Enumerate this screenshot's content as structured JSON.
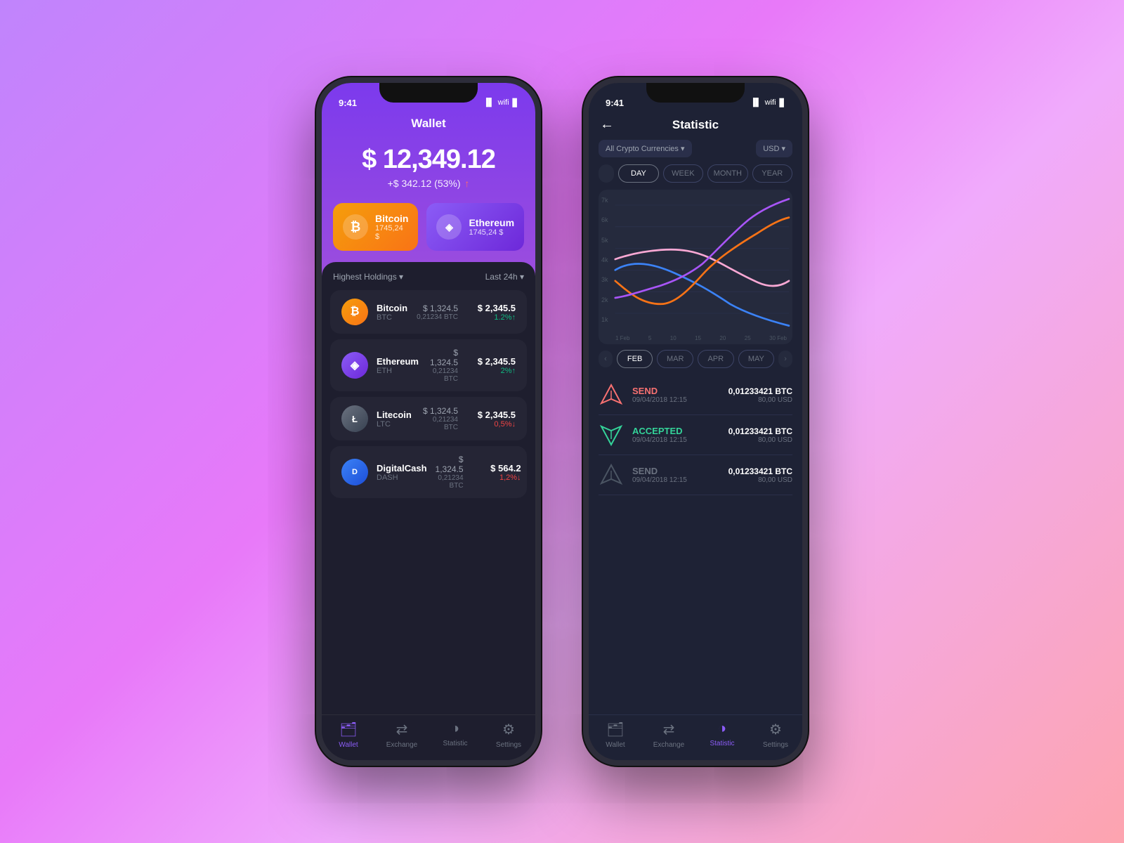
{
  "background": "#d946ef",
  "phone1": {
    "status_time": "9:41",
    "screen_title": "Wallet",
    "balance": "$ 12,349.12",
    "balance_change": "+$ 342.12 (53%)",
    "cards": [
      {
        "name": "Bitcoin",
        "amount": "1745,24 $",
        "type": "bitcoin"
      },
      {
        "name": "Ethereum",
        "amount": "1745,24 $",
        "type": "ethereum"
      }
    ],
    "list_header_left": "Highest Holdings ▾",
    "list_header_right": "Last 24h ▾",
    "coins": [
      {
        "name": "Bitcoin",
        "ticker": "BTC",
        "price": "$ 1,324.5",
        "btc": "0,21234 BTC",
        "value": "$ 2,345.5",
        "change": "1.2%↑",
        "change_type": "up",
        "type": "btc"
      },
      {
        "name": "Ethereum",
        "ticker": "ETH",
        "price": "$ 1,324.5",
        "btc": "0,21234 BTC",
        "value": "$ 2,345.5",
        "change": "2%↑",
        "change_type": "up",
        "type": "eth"
      },
      {
        "name": "Litecoin",
        "ticker": "LTC",
        "price": "$ 1,324.5",
        "btc": "0,21234 BTC",
        "value": "$ 2,345.5",
        "change": "0,5%↓",
        "change_type": "down",
        "type": "ltc"
      },
      {
        "name": "DigitalCash",
        "ticker": "DASH",
        "price": "$ 1,324.5",
        "btc": "0,21234 BTC",
        "value": "$ 564.2",
        "change": "1,2%↓",
        "change_type": "down",
        "type": "dash"
      }
    ],
    "nav": [
      {
        "label": "Wallet",
        "active": true
      },
      {
        "label": "Exchange",
        "active": false
      },
      {
        "label": "Statistic",
        "active": false
      },
      {
        "label": "Settings",
        "active": false
      }
    ]
  },
  "phone2": {
    "status_time": "9:41",
    "screen_title": "Statistic",
    "filter_currency": "All Crypto Currencies ▾",
    "filter_unit": "USD ▾",
    "period_tabs": [
      "DAY",
      "WEEK",
      "MONTH",
      "YEAR"
    ],
    "active_period": "DAY",
    "chart_y_labels": [
      "7k",
      "6k",
      "5k",
      "4k",
      "3k",
      "2k",
      "1k"
    ],
    "chart_x_labels": [
      "1 Feb",
      "5",
      "10",
      "15",
      "20",
      "25",
      "30 Feb"
    ],
    "month_tabs": [
      "FEB",
      "MAR",
      "APR",
      "MAY"
    ],
    "active_month": "FEB",
    "transactions": [
      {
        "type": "SEND",
        "type_class": "send",
        "date": "09/04/2018 12:15",
        "btc": "0,01233421 BTC",
        "usd": "80,00 USD"
      },
      {
        "type": "ACCEPTED",
        "type_class": "accepted",
        "date": "09/04/2018 12:15",
        "btc": "0,01233421 BTC",
        "usd": "80,00 USD"
      },
      {
        "type": "SEND",
        "type_class": "send-grey",
        "date": "09/04/2018 12:15",
        "btc": "0,01233421 BTC",
        "usd": "80,00 USD"
      }
    ],
    "nav": [
      {
        "label": "Wallet",
        "active": false
      },
      {
        "label": "Exchange",
        "active": false
      },
      {
        "label": "Statistic",
        "active": true
      },
      {
        "label": "Settings",
        "active": false
      }
    ]
  }
}
